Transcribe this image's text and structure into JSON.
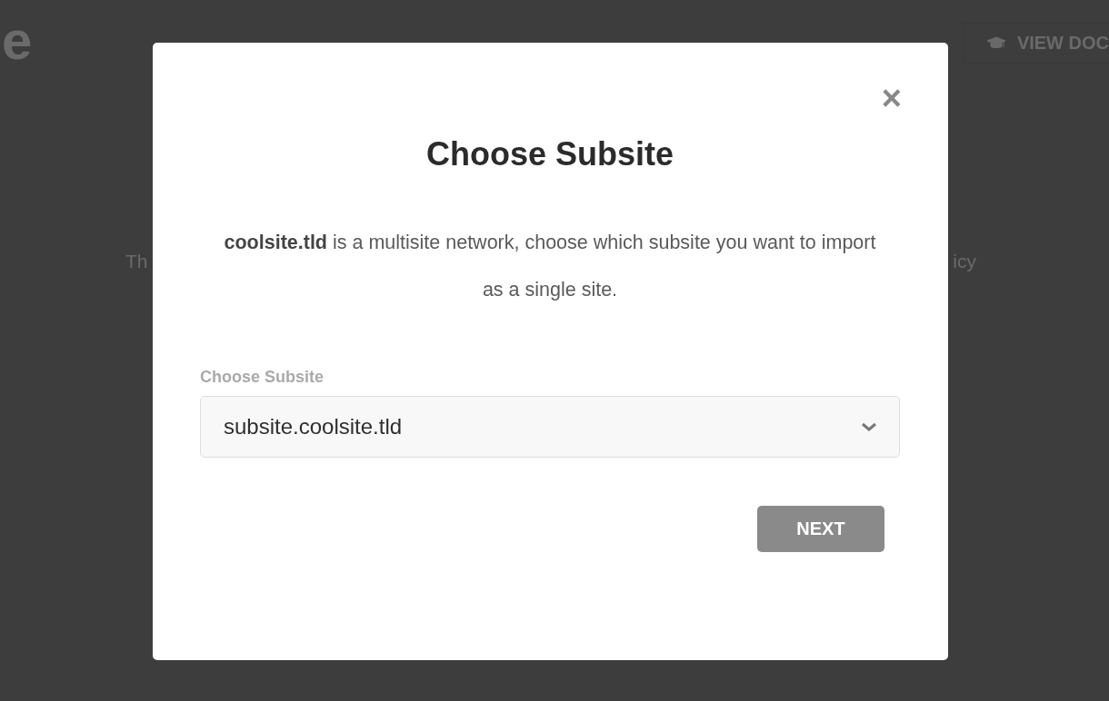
{
  "background": {
    "logo_fragment": "e",
    "docs_button": "VIEW DOC",
    "text_left": "Th",
    "text_right": "icy"
  },
  "dialog": {
    "title": "Choose Subsite",
    "close": "×",
    "message": "**coolsite.tld** is a multisite network, choose which subsite you want to import as a single site.",
    "select": {
      "label": "Choose Subsite",
      "value": "subsite.coolsite.tld"
    },
    "buttons": [
      "NEXT"
    ]
  }
}
